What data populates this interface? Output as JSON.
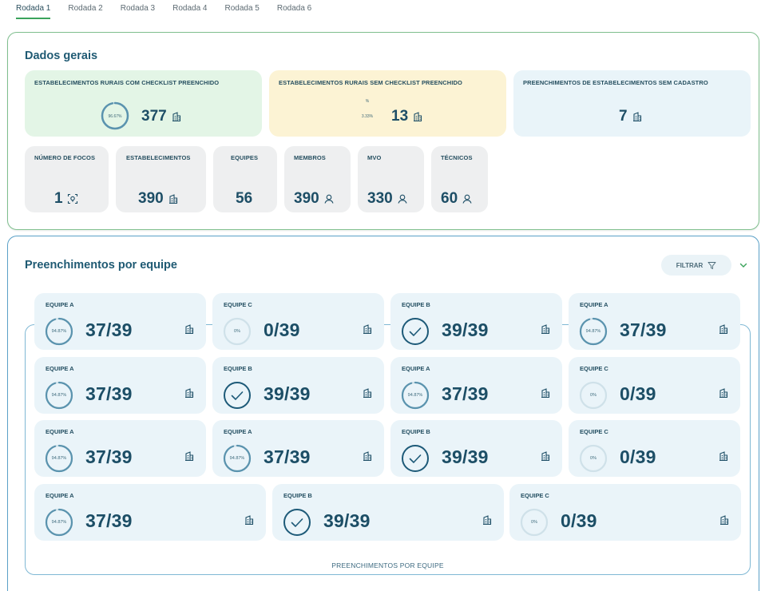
{
  "tabs": [
    "Rodada 1",
    "Rodada 2",
    "Rodada 3",
    "Rodada 4",
    "Rodada 5",
    "Rodada 6"
  ],
  "dados_gerais": {
    "title": "Dados gerais",
    "com_checklist": {
      "label": "ESTABELECIMENTOS RURAIS COM CHECKLIST PREENCHIDO",
      "value": "377",
      "pct": "96.67%"
    },
    "sem_checklist": {
      "label": "ESTABELECIMENTOS RURAIS SEM CHECKLIST PREENCHIDO",
      "value": "13",
      "pct": "3.33%",
      "mark": "%"
    },
    "sem_cadastro": {
      "label": "PREENCHIMENTOS DE ESTABELECIMENTOS SEM CADASTRO",
      "value": "7"
    },
    "small": [
      {
        "label": "NÚMERO DE FOCOS",
        "value": "1",
        "icon": "focus-icon"
      },
      {
        "label": "ESTABELECIMENTOS",
        "value": "390",
        "icon": "building-icon"
      },
      {
        "label": "EQUIPES",
        "value": "56",
        "icon": ""
      },
      {
        "label": "MEMBROS",
        "value": "390",
        "icon": "user-icon"
      },
      {
        "label": "MVO",
        "value": "330",
        "icon": "user-icon"
      },
      {
        "label": "TÉCNICOS",
        "value": "60",
        "icon": "user-icon"
      }
    ]
  },
  "preenchimentos": {
    "title": "Preenchimentos por equipe",
    "filter_label": "FILTRAR",
    "caption": "PREENCHIMENTOS POR EQUIPE",
    "teams": [
      {
        "name": "EQUIPE A",
        "value": "37/39",
        "pct": "94.87%",
        "progress": 0.9487,
        "status": "partial"
      },
      {
        "name": "EQUIPE C",
        "value": "0/39",
        "pct": "0%",
        "progress": 0,
        "status": "empty"
      },
      {
        "name": "EQUIPE B",
        "value": "39/39",
        "pct": "",
        "progress": 1,
        "status": "complete"
      },
      {
        "name": "EQUIPE A",
        "value": "37/39",
        "pct": "94.87%",
        "progress": 0.9487,
        "status": "partial"
      },
      {
        "name": "EQUIPE A",
        "value": "37/39",
        "pct": "94.87%",
        "progress": 0.9487,
        "status": "partial"
      },
      {
        "name": "EQUIPE B",
        "value": "39/39",
        "pct": "",
        "progress": 1,
        "status": "complete"
      },
      {
        "name": "EQUIPE A",
        "value": "37/39",
        "pct": "94.87%",
        "progress": 0.9487,
        "status": "partial"
      },
      {
        "name": "EQUIPE C",
        "value": "0/39",
        "pct": "0%",
        "progress": 0,
        "status": "empty"
      },
      {
        "name": "EQUIPE A",
        "value": "37/39",
        "pct": "94.87%",
        "progress": 0.9487,
        "status": "partial"
      },
      {
        "name": "EQUIPE A",
        "value": "37/39",
        "pct": "94.87%",
        "progress": 0.9487,
        "status": "partial"
      },
      {
        "name": "EQUIPE B",
        "value": "39/39",
        "pct": "",
        "progress": 1,
        "status": "complete"
      },
      {
        "name": "EQUIPE C",
        "value": "0/39",
        "pct": "0%",
        "progress": 0,
        "status": "empty"
      },
      {
        "name": "EQUIPE A",
        "value": "37/39",
        "pct": "94.87%",
        "progress": 0.9487,
        "status": "partial"
      },
      {
        "name": "EQUIPE B",
        "value": "39/39",
        "pct": "",
        "progress": 1,
        "status": "complete"
      },
      {
        "name": "EQUIPE C",
        "value": "0/39",
        "pct": "0%",
        "progress": 0,
        "status": "empty"
      }
    ]
  },
  "colors": {
    "accent": "#1f5a73",
    "green_card": "#e3f5e6",
    "yellow_card": "#fcf3d4",
    "blue_card": "#e9f4f9",
    "grey_card": "#eeeff0",
    "tab_active": "#3aa35b"
  }
}
